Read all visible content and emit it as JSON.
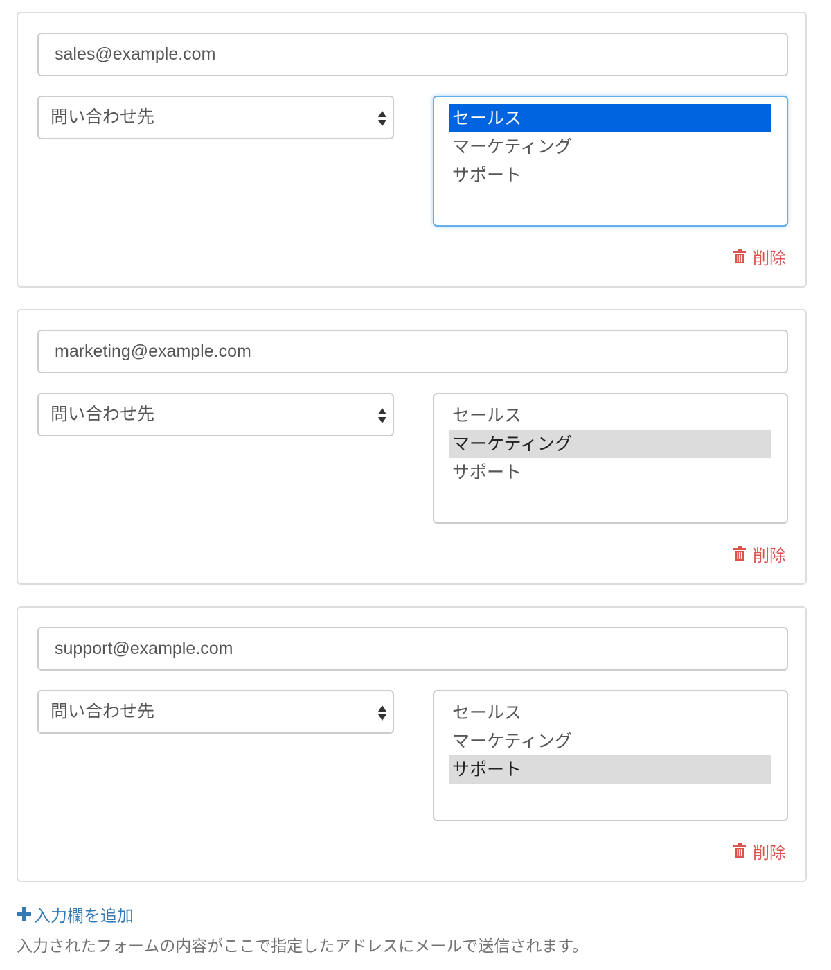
{
  "entries": [
    {
      "email": "sales@example.com",
      "select_value": "問い合わせ先",
      "options": [
        "セールス",
        "マーケティング",
        "サポート"
      ],
      "selected_index": 0,
      "listbox_focused": true,
      "delete_label": "削除"
    },
    {
      "email": "marketing@example.com",
      "select_value": "問い合わせ先",
      "options": [
        "セールス",
        "マーケティング",
        "サポート"
      ],
      "selected_index": 1,
      "listbox_focused": false,
      "delete_label": "削除"
    },
    {
      "email": "support@example.com",
      "select_value": "問い合わせ先",
      "options": [
        "セールス",
        "マーケティング",
        "サポート"
      ],
      "selected_index": 2,
      "listbox_focused": false,
      "delete_label": "削除"
    }
  ],
  "add_entry_label": "入力欄を追加",
  "help_text": "入力されたフォームの内容がここで指定したアドレスにメールで送信されます。",
  "icons": {
    "delete": "trash-icon",
    "add": "plus-icon",
    "select": "select-arrows-icon"
  },
  "colors": {
    "link": "#337ab7",
    "danger": "#d9534f",
    "selection_focused": "#0064e1",
    "selection_inactive": "#dcdcdc",
    "focus_border": "#66afe9"
  }
}
